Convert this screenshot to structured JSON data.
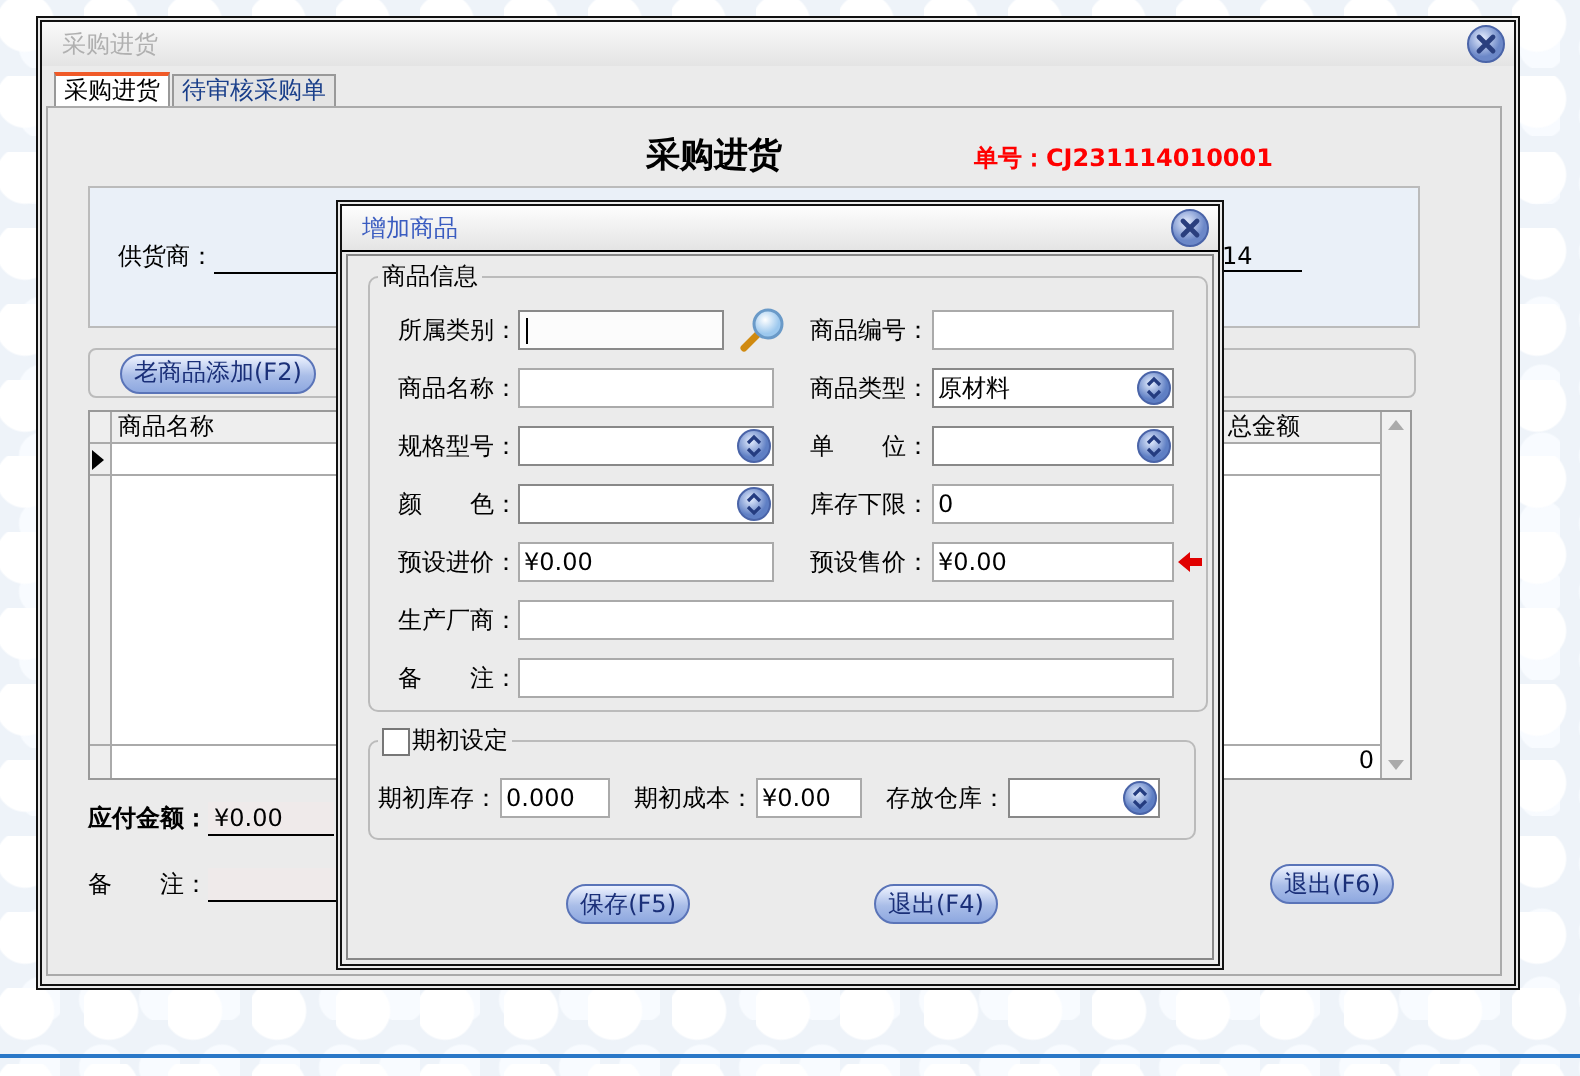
{
  "window": {
    "title": "采购进货"
  },
  "tabs": [
    {
      "label": "采购进货",
      "selected": true
    },
    {
      "label": "待审核采购单",
      "selected": false
    }
  ],
  "form": {
    "heading": "采购进货",
    "order_no": "单号：CJ231114010001",
    "supplier_label": "供货商：",
    "date_fragment": "14"
  },
  "toolbar": {
    "buttons": [
      "老商品添加(F2)"
    ]
  },
  "grid": {
    "columns": [
      "商品名称",
      "总金额"
    ],
    "footer_total": "0"
  },
  "payable": {
    "label": "应付金额：",
    "value": "¥0.00"
  },
  "remark": {
    "label": "备　　注："
  },
  "exit_button": "退出(F6)",
  "dialog": {
    "title": "增加商品",
    "info_group": {
      "legend": "商品信息",
      "rows": [
        [
          {
            "label": "所属类别：",
            "kind": "lookup",
            "focused": true
          },
          {
            "label": "商品编号：",
            "kind": "text",
            "focused": false
          }
        ],
        [
          {
            "label": "商品名称：",
            "kind": "text",
            "focused": false
          },
          {
            "label": "商品类型：",
            "kind": "select",
            "value": "原材料",
            "focused": false
          }
        ],
        [
          {
            "label": "规格型号：",
            "kind": "select",
            "focused": false
          },
          {
            "label": "单　　位：",
            "kind": "select",
            "focused": false
          }
        ],
        [
          {
            "label": "颜　　色：",
            "kind": "select",
            "focused": false
          },
          {
            "label": "库存下限：",
            "kind": "text",
            "value": "0",
            "focused": false
          }
        ],
        [
          {
            "label": "预设进价：",
            "kind": "text",
            "value": "¥0.00",
            "focused": false
          },
          {
            "label": "预设售价：",
            "kind": "flagged",
            "value": "¥0.00",
            "focused": false
          }
        ],
        [
          {
            "label": "生产厂商：",
            "kind": "wide",
            "focused": false
          }
        ],
        [
          {
            "label": "备　　注：",
            "kind": "wide",
            "focused": false
          }
        ]
      ]
    },
    "initial_group": {
      "legend": "期初设定",
      "checked": false,
      "fields": [
        {
          "label": "期初库存：",
          "kind": "text",
          "value": "0.000"
        },
        {
          "label": "期初成本：",
          "kind": "text",
          "value": "¥0.00"
        },
        {
          "label": "存放仓库：",
          "kind": "select"
        }
      ]
    },
    "buttons": [
      "保存(F5)",
      "退出(F4)"
    ]
  }
}
